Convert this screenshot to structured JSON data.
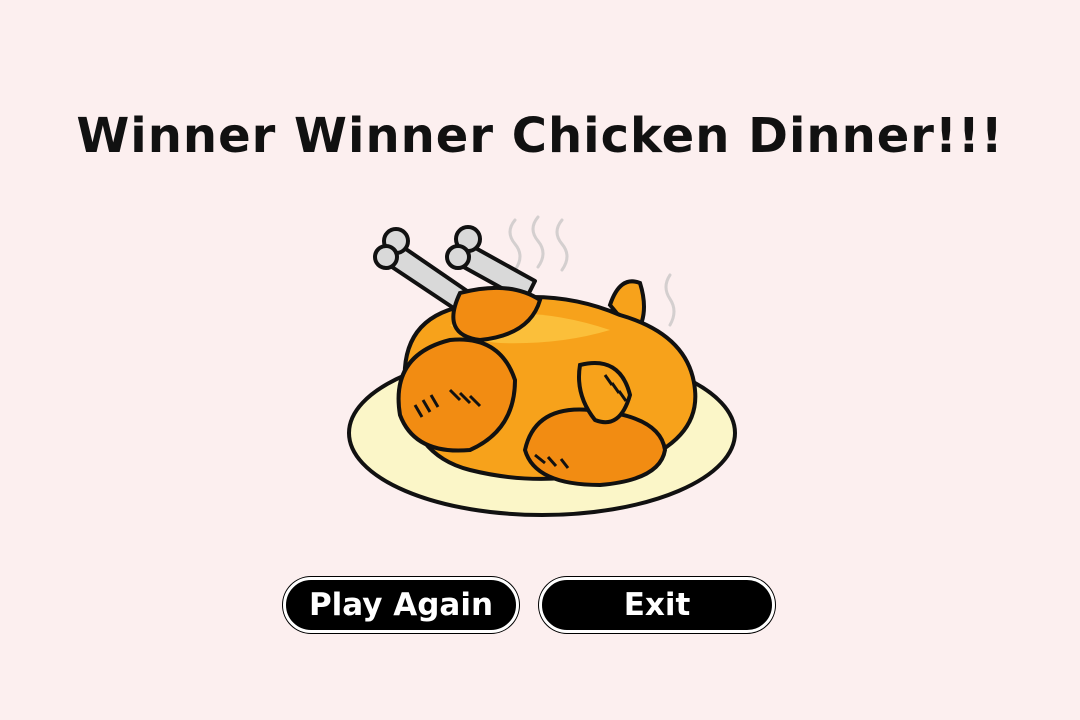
{
  "title": "Winner Winner Chicken Dinner!!!",
  "buttons": {
    "play_again_label": "Play Again",
    "exit_label": "Exit"
  },
  "illustration": {
    "icon": "roast-chicken-icon"
  },
  "colors": {
    "background": "#fcefef",
    "button": "#000000",
    "button_text": "#ffffff",
    "chicken_body": "#f7a21b",
    "plate": "#fbf6c8"
  }
}
